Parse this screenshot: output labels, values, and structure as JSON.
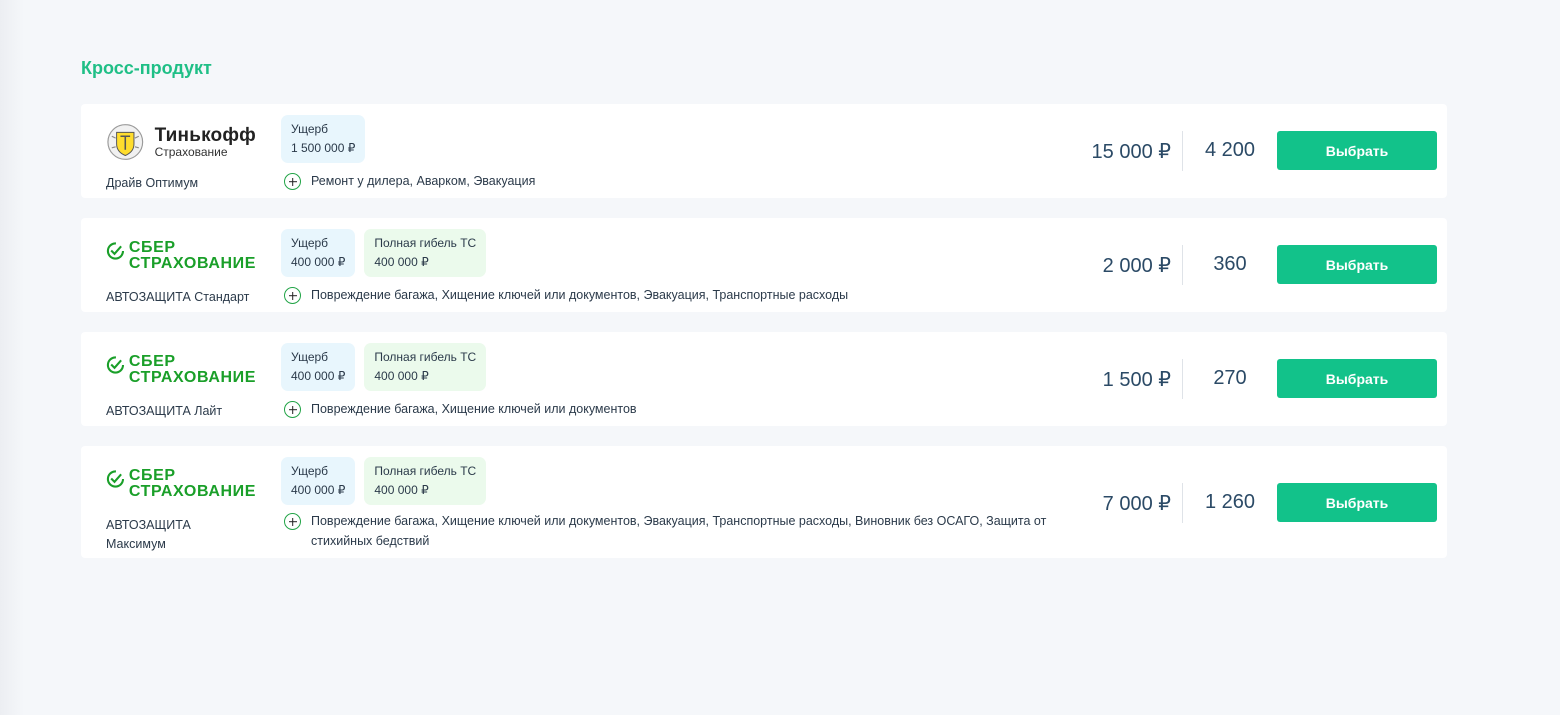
{
  "section": {
    "title": "Кросс-продукт",
    "select_label": "Выбрать"
  },
  "products": [
    {
      "insurer": {
        "name": "Тинькофф",
        "subtitle": "Страхование"
      },
      "product_name": "Драйв Оптимум",
      "tags": [
        {
          "label": "Ущерб",
          "value": "1 500 000 ₽",
          "color": "blue"
        }
      ],
      "options": "Ремонт у дилера, Аварком, Эвакуация",
      "price": "15 000 ₽",
      "bonus": "4 200"
    },
    {
      "insurer": {
        "name_line1": "СБЕР",
        "name_line2": "СТРАХОВАНИЕ"
      },
      "product_name": "АВТОЗАЩИТА Стандарт",
      "tags": [
        {
          "label": "Ущерб",
          "value": "400 000 ₽",
          "color": "blue"
        },
        {
          "label": "Полная гибель ТС",
          "value": "400 000 ₽",
          "color": "green"
        }
      ],
      "options": "Повреждение багажа, Хищение ключей или документов, Эвакуация, Транспортные расходы",
      "price": "2 000 ₽",
      "bonus": "360"
    },
    {
      "insurer": {
        "name_line1": "СБЕР",
        "name_line2": "СТРАХОВАНИЕ"
      },
      "product_name": "АВТОЗАЩИТА Лайт",
      "tags": [
        {
          "label": "Ущерб",
          "value": "400 000 ₽",
          "color": "blue"
        },
        {
          "label": "Полная гибель ТС",
          "value": "400 000 ₽",
          "color": "green"
        }
      ],
      "options": "Повреждение багажа, Хищение ключей или документов",
      "price": "1 500 ₽",
      "bonus": "270"
    },
    {
      "insurer": {
        "name_line1": "СБЕР",
        "name_line2": "СТРАХОВАНИЕ"
      },
      "product_name": "АВТОЗАЩИТА Максимум",
      "tags": [
        {
          "label": "Ущерб",
          "value": "400 000 ₽",
          "color": "blue"
        },
        {
          "label": "Полная гибель ТС",
          "value": "400 000 ₽",
          "color": "green"
        }
      ],
      "options": "Повреждение багажа, Хищение ключей или документов, Эвакуация, Транспортные расходы, Виновник без ОСАГО, Защита от стихийных бедствий",
      "price": "7 000 ₽",
      "bonus": "1 260"
    }
  ],
  "colors": {
    "accent": "#1fbf86",
    "button": "#12c28a",
    "sber_green": "#1a9f29",
    "tag_blue": "#e8f6fd",
    "tag_green": "#ebfaec"
  }
}
